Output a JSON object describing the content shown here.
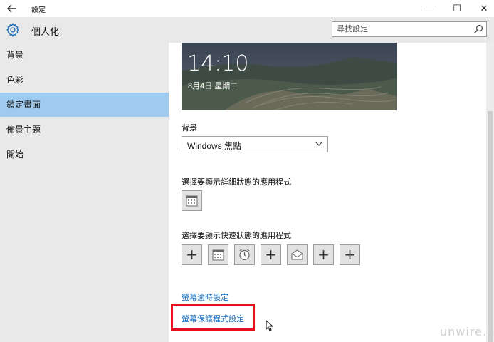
{
  "window": {
    "back_icon": "arrow-left-icon",
    "title": "設定",
    "controls": {
      "minimize": "—",
      "maximize": "☐",
      "close": "✕"
    }
  },
  "header": {
    "icon": "gear-icon",
    "title": "個人化",
    "search_placeholder": "尋找設定",
    "search_icon": "search-icon"
  },
  "sidebar": {
    "items": [
      {
        "label": "背景",
        "active": false
      },
      {
        "label": "色彩",
        "active": false
      },
      {
        "label": "鎖定畫面",
        "active": true
      },
      {
        "label": "佈景主題",
        "active": false
      },
      {
        "label": "開始",
        "active": false
      }
    ],
    "active_color": "#9fcbf0"
  },
  "preview": {
    "time": "14:10",
    "date": "8月4日 星期二"
  },
  "background": {
    "label": "背景",
    "selected": "Windows 焦點"
  },
  "detailed_status": {
    "label": "選擇要顯示詳細狀態的應用程式",
    "app_icon": "calendar-icon"
  },
  "quick_status": {
    "label": "選擇要顯示快速狀態的應用程式",
    "apps": [
      "plus-icon",
      "calendar-icon",
      "alarm-clock-icon",
      "plus-icon",
      "mail-icon",
      "plus-icon",
      "plus-icon"
    ],
    "plus_glyph": "+"
  },
  "links": {
    "screen_timeout": "螢幕逾時設定",
    "screen_saver": "螢幕保護程式設定"
  },
  "watermark": "unwire.hk",
  "colors": {
    "link": "#1a6fbf",
    "highlight": "#e8101c"
  }
}
